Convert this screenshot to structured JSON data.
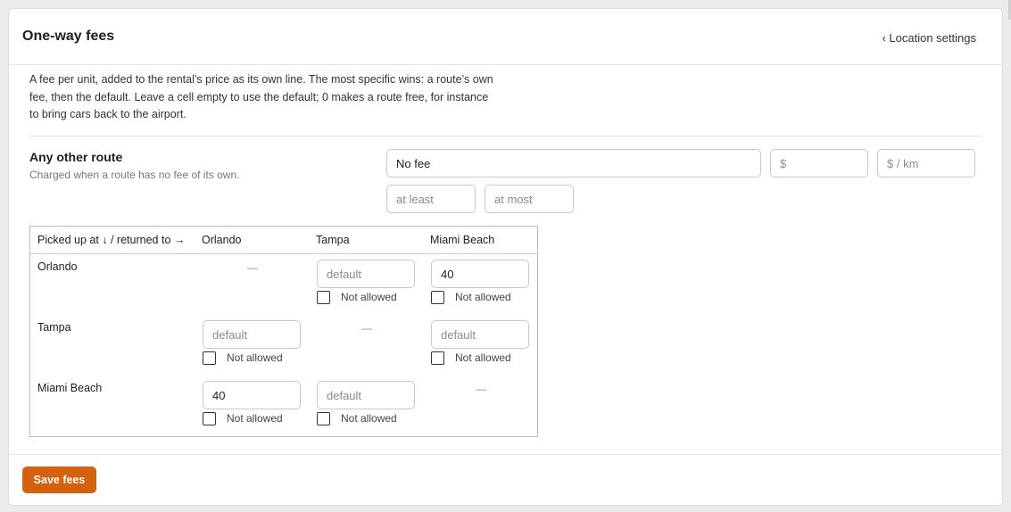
{
  "header": {
    "title": "One-way fees",
    "back_link": "‹ Location settings"
  },
  "description": "A fee per unit, added to the rental’s price as its own line. The most specific wins: a route’s own fee, then the default. Leave a cell empty to use the default; 0 makes a route free, for instance to bring cars back to the airport.",
  "default_route": {
    "title": "Any other route",
    "subtitle": "Charged when a route has no fee of its own.",
    "fee_type_value": "No fee",
    "amount_placeholder": "$",
    "per_km_placeholder": "$ / km",
    "min_placeholder": "at least",
    "max_placeholder": "at most"
  },
  "matrix": {
    "corner_header": "Picked up at ↓ / returned to →",
    "columns": [
      "Orlando",
      "Tampa",
      "Miami Beach"
    ],
    "dash": "—",
    "cell_placeholder": "default",
    "not_allowed_label": "Not allowed",
    "rows": [
      {
        "label": "Orlando",
        "cells": [
          null,
          "",
          "40"
        ]
      },
      {
        "label": "Tampa",
        "cells": [
          "",
          null,
          ""
        ]
      },
      {
        "label": "Miami Beach",
        "cells": [
          "40",
          "",
          null
        ]
      }
    ]
  },
  "footer": {
    "save_label": "Save fees"
  },
  "colors": {
    "accent": "#d5600e"
  }
}
